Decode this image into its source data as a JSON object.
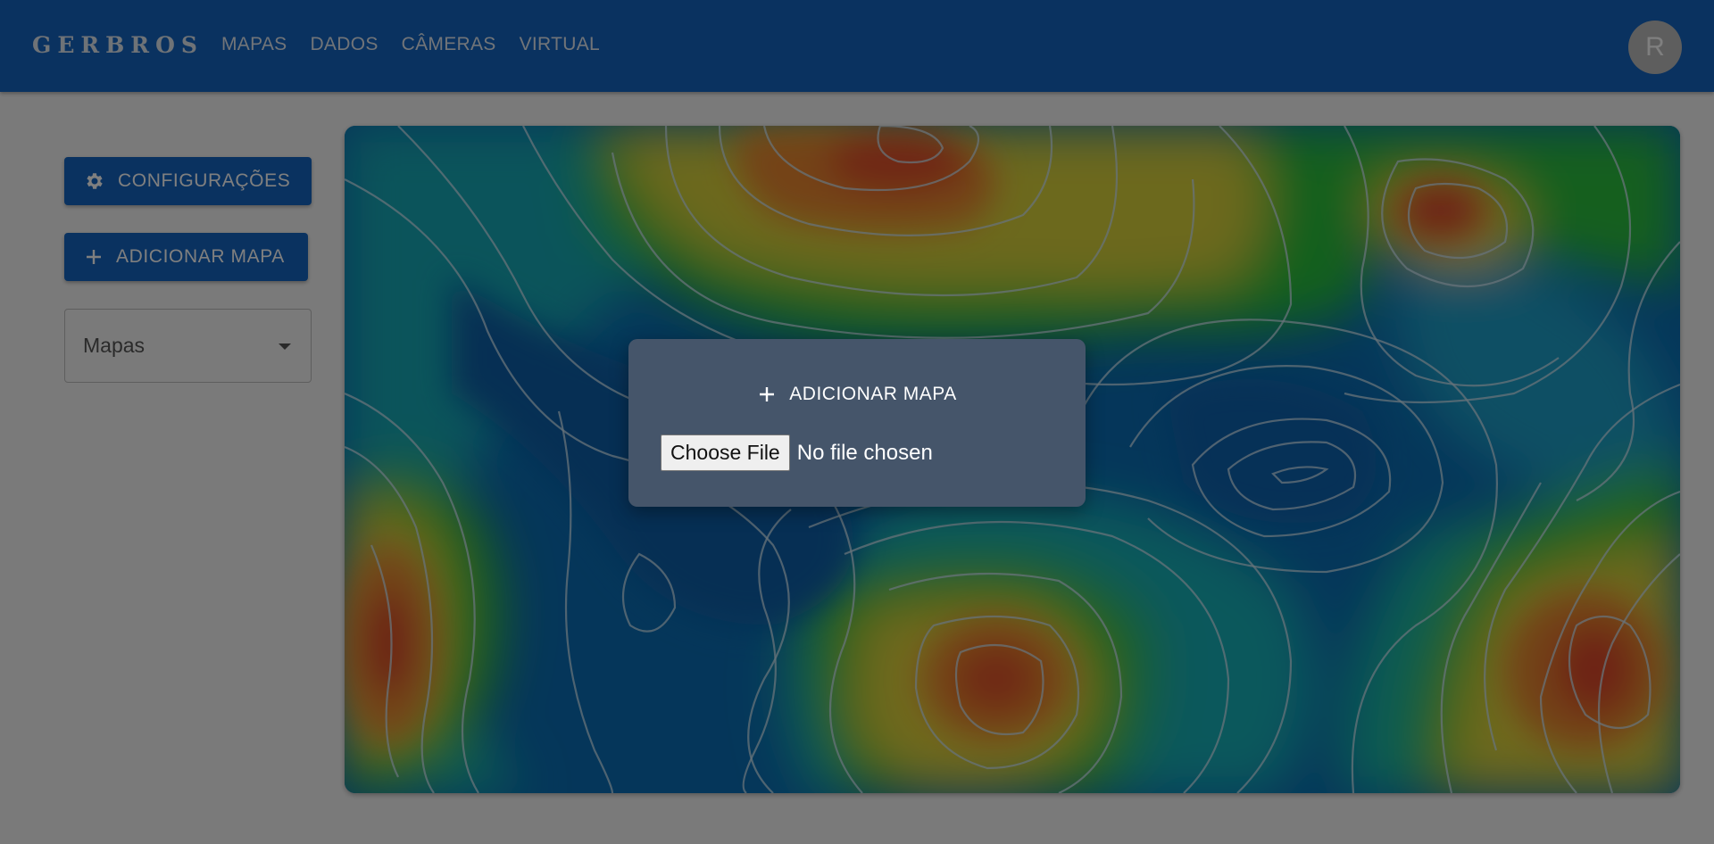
{
  "appbar": {
    "brand": "GERBROS",
    "nav": [
      "MAPAS",
      "DADOS",
      "CÂMERAS",
      "VIRTUAL"
    ],
    "avatar_letter": "R",
    "color": "#1565c0"
  },
  "sidebar": {
    "config_button": {
      "label": "CONFIGURAÇÕES",
      "icon": "gear-icon"
    },
    "add_button": {
      "label": "ADICIONAR MAPA",
      "icon": "plus-icon"
    },
    "maps_select": {
      "placeholder": "Mapas"
    }
  },
  "dialog": {
    "title": "ADICIONAR MAPA",
    "title_icon": "plus-icon",
    "file_button": "Choose File",
    "file_status": "No file chosen"
  }
}
